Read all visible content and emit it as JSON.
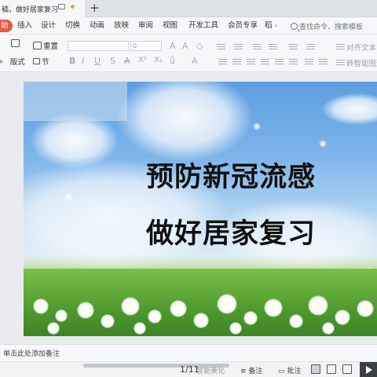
{
  "tab": {
    "title": "稿，做好居家复习"
  },
  "menu": {
    "start": "始",
    "items": [
      "插入",
      "设计",
      "切换",
      "动画",
      "放映",
      "审阅",
      "视图",
      "开发工具",
      "会员专享",
      "稻"
    ],
    "search_placeholder": "查找命令、搜索模板"
  },
  "toolbar": {
    "reset": "重置",
    "layout": "版式",
    "section": "节",
    "font_size": "0",
    "align_text": "对齐文本",
    "smart_graphic": "转智能图形"
  },
  "slide": {
    "line1": "预防新冠流感",
    "line2": "做好居家复习"
  },
  "notes": {
    "placeholder": "单击此处添加备注"
  },
  "status": {
    "page": "1/11",
    "beautify": "智能美化",
    "notes": "备注",
    "comments": "批注"
  }
}
